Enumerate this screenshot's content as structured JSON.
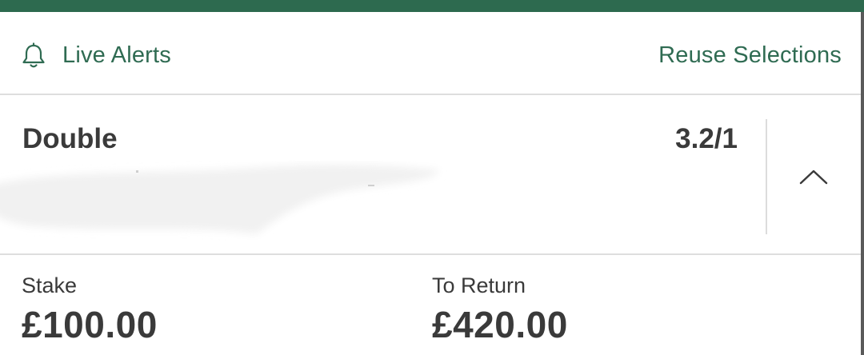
{
  "colors": {
    "brand_green": "#2d6a4f",
    "link_green": "#2f6b52",
    "text_dark": "#3a3a3a",
    "divider": "#dedede"
  },
  "actions": {
    "live_alerts_label": "Live Alerts",
    "live_alerts_icon": "bell-icon",
    "reuse_selections_label": "Reuse Selections"
  },
  "bet": {
    "type": "Double",
    "odds": "3.2/1",
    "toggle_icon": "chevron-up-icon"
  },
  "totals": {
    "stake_label": "Stake",
    "stake_value": "£100.00",
    "return_label": "To Return",
    "return_value": "£420.00"
  }
}
